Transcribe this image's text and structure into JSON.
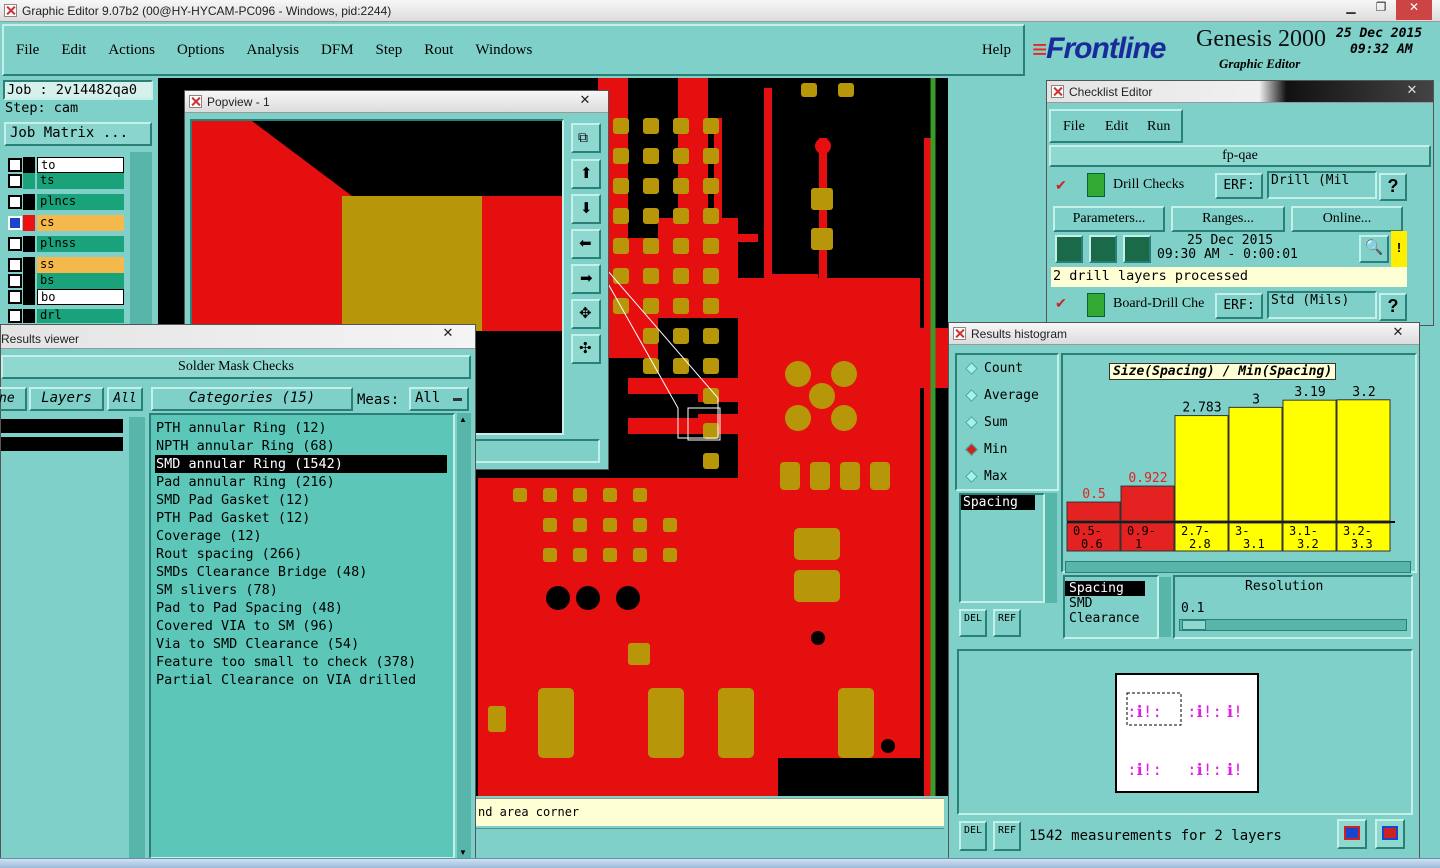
{
  "window": {
    "title": "Graphic Editor 9.07b2 (00@HY-HYCAM-PC096 - Windows, pid:2244)"
  },
  "menu": {
    "items": [
      "File",
      "Edit",
      "Actions",
      "Options",
      "Analysis",
      "DFM",
      "Step",
      "Rout",
      "Windows"
    ],
    "help": "Help"
  },
  "brand": {
    "logo": "Frontline",
    "product": "Genesis 2000",
    "subtitle": "Graphic Editor",
    "date": "25 Dec 2015",
    "time": "09:32 AM"
  },
  "job": {
    "job_label": "Job : 2v14482qa0",
    "step_label": "Step: cam",
    "matrix_button": "Job Matrix ..."
  },
  "layers": [
    {
      "name": "to",
      "color": "#ffffff"
    },
    {
      "name": "ts",
      "color": "#1aa37a"
    },
    {
      "name": "plncs",
      "color": "#1aa37a"
    },
    {
      "name": "cs",
      "color": "#f5b84c"
    },
    {
      "name": "plnss",
      "color": "#1aa37a"
    },
    {
      "name": "ss",
      "color": "#f5b84c"
    },
    {
      "name": "bs",
      "color": "#1aa37a"
    },
    {
      "name": "bo",
      "color": "#ffffff"
    },
    {
      "name": "drl",
      "color": "#1aa37a"
    }
  ],
  "popview": {
    "title": "Popview - 1"
  },
  "results_viewer": {
    "title": "Results viewer",
    "heading": "Solder Mask Checks",
    "tab_one": "ne",
    "tab_layers": "Layers",
    "tab_all": "All",
    "categories_label": "Categories (15)",
    "meas_label": "Meas:",
    "meas_value": "All",
    "categories": [
      "PTH annular Ring (12)",
      "NPTH annular Ring (68)",
      "SMD annular Ring (1542)",
      "Pad annular Ring (216)",
      "SMD Pad Gasket (12)",
      "PTH Pad Gasket (12)",
      "Coverage (12)",
      "Rout spacing (266)",
      "SMDs Clearance Bridge (48)",
      "SM slivers (78)",
      "Pad to Pad Spacing (48)",
      "Covered VIA to SM (96)",
      "Via to SMD Clearance (54)",
      "Feature too small to check (378)",
      "Partial Clearance on VIA drilled"
    ],
    "selected_index": 2
  },
  "status_line": "nd area corner",
  "checklist": {
    "title": "Checklist Editor",
    "menu": [
      "File",
      "Edit",
      "Run"
    ],
    "name": "fp-qae",
    "check1": {
      "label": "Drill Checks",
      "erf": "ERF:",
      "erf_value": "Drill (Mil"
    },
    "buttons": [
      "Parameters...",
      "Ranges...",
      "Online..."
    ],
    "run_date": "25 Dec 2015",
    "run_time": "09:30 AM - 0:00:01",
    "status": "2 drill layers processed",
    "check2": {
      "label": "Board-Drill Che",
      "erf": "ERF:",
      "erf_value": "Std (Mils)"
    },
    "help": "?"
  },
  "histogram": {
    "title": "Results histogram",
    "modes": [
      "Count",
      "Average",
      "Sum",
      "Min",
      "Max"
    ],
    "selected_mode": "Min",
    "chart_title": "Size(Spacing) / Min(Spacing)",
    "measure_list": [
      "Spacing"
    ],
    "field_list": [
      "Spacing",
      "SMD",
      "Clearance"
    ],
    "resolution_label": "Resolution",
    "resolution_value": "0.1",
    "del": "DEL",
    "ref": "REF",
    "summary": "1542 measurements for 2 layers"
  },
  "chart_data": {
    "type": "bar",
    "title": "Size(Spacing) / Min(Spacing)",
    "categories": [
      "0.5-0.6",
      "0.9-1",
      "2.7-2.8",
      "3-3.1",
      "3.1-3.2",
      "3.2-3.3"
    ],
    "values": [
      0.5,
      0.922,
      2.783,
      3,
      3.19,
      3.2
    ],
    "value_labels": [
      "0.5",
      "0.922",
      "2.783",
      "3",
      "3.19",
      "3.2"
    ],
    "colors": [
      "#e52222",
      "#e52222",
      "#ffff00",
      "#ffff00",
      "#ffff00",
      "#ffff00"
    ]
  },
  "colors": {
    "copper": "#e60f0f",
    "pad": "#b8960a",
    "teal": "#7fd0c8",
    "panel": "#5cc7b8"
  }
}
